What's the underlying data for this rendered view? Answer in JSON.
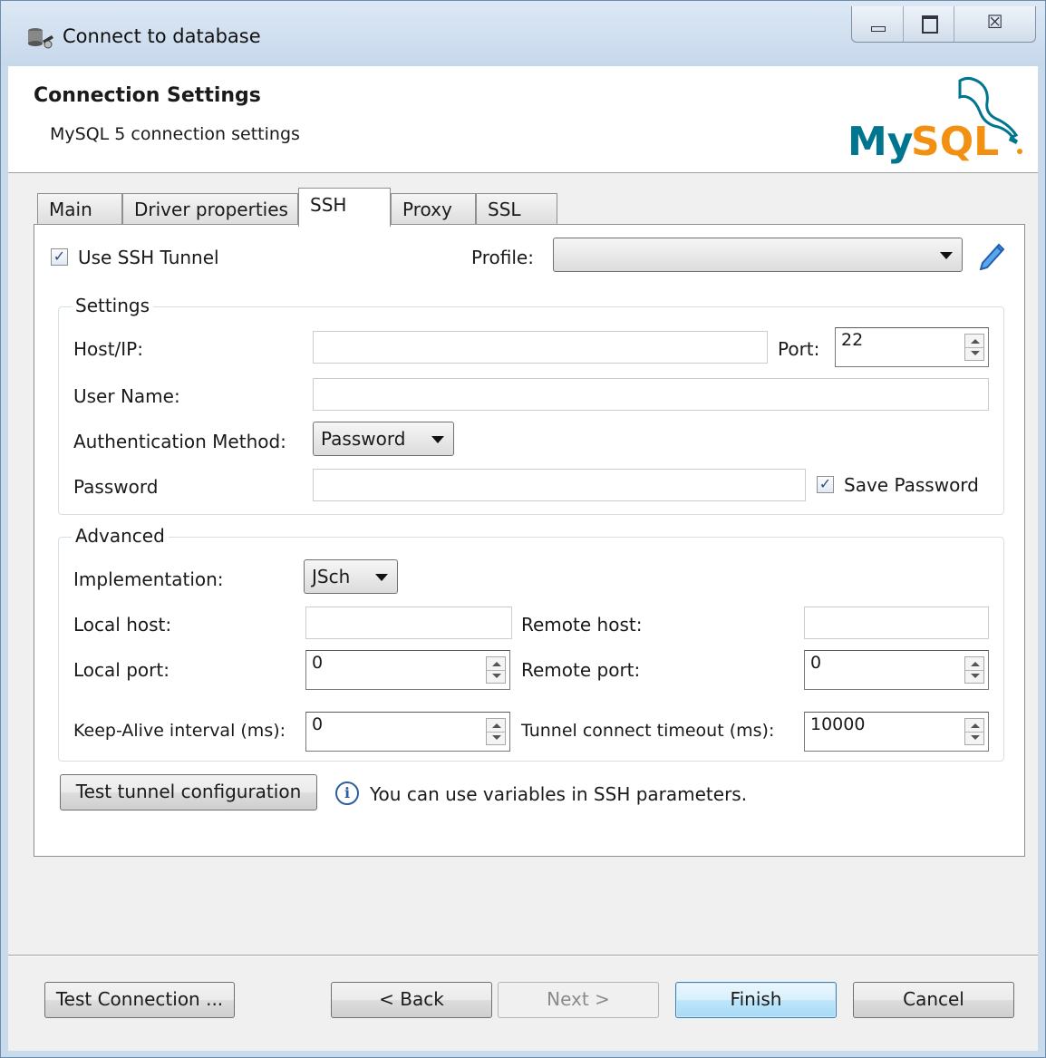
{
  "window": {
    "title": "Connect to database",
    "close_glyph": "☒"
  },
  "header": {
    "title": "Connection Settings",
    "subtitle": "MySQL 5 connection settings",
    "logo_text": "MySQL"
  },
  "tabs": [
    {
      "label": "Main"
    },
    {
      "label": "Driver properties"
    },
    {
      "label": "SSH",
      "active": true
    },
    {
      "label": "Proxy"
    },
    {
      "label": "SSL"
    }
  ],
  "ssh": {
    "use_tunnel_label": "Use SSH Tunnel",
    "use_tunnel_checked": true,
    "profile_label": "Profile:",
    "profile_value": "",
    "settings": {
      "title": "Settings",
      "host_label": "Host/IP:",
      "host_value": "",
      "port_label": "Port:",
      "port_value": "22",
      "user_label": "User Name:",
      "user_value": "",
      "auth_label": "Authentication Method:",
      "auth_value": "Password",
      "password_label": "Password",
      "password_value": "",
      "save_password_label": "Save Password",
      "save_password_checked": true
    },
    "advanced": {
      "title": "Advanced",
      "impl_label": "Implementation:",
      "impl_value": "JSch",
      "local_host_label": "Local host:",
      "local_host_value": "",
      "remote_host_label": "Remote host:",
      "remote_host_value": "",
      "local_port_label": "Local port:",
      "local_port_value": "0",
      "remote_port_label": "Remote port:",
      "remote_port_value": "0",
      "keepalive_label": "Keep-Alive interval (ms):",
      "keepalive_value": "0",
      "timeout_label": "Tunnel connect timeout (ms):",
      "timeout_value": "10000"
    },
    "test_tunnel_label": "Test tunnel configuration",
    "info_text": "You can use variables in SSH parameters."
  },
  "footer": {
    "test_connection": "Test Connection ...",
    "back": "< Back",
    "next": "Next >",
    "finish": "Finish",
    "cancel": "Cancel"
  },
  "colors": {
    "accent": "#3c7fb1",
    "mysql_blue": "#00758f",
    "mysql_orange": "#f29111",
    "pencil": "#2c7fd6"
  },
  "icons": [
    "database-connect-icon",
    "minimize-icon",
    "maximize-icon",
    "close-icon",
    "dropdown-arrow-icon",
    "edit-pencil-icon",
    "info-icon",
    "checkbox-checked-icon"
  ]
}
